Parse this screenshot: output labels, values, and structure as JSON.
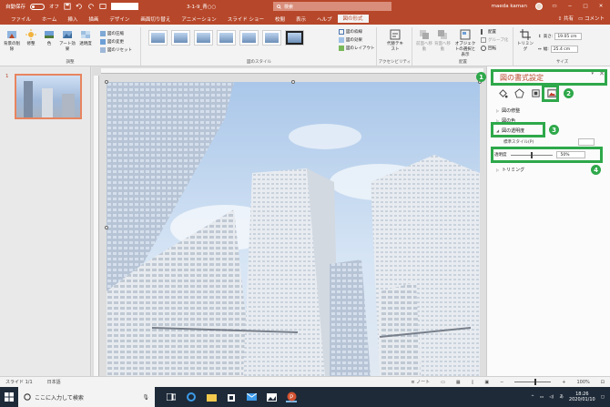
{
  "titlebar": {
    "autosave_label": "自動保存",
    "autosave_state": "オフ",
    "file_name": "3-1-9_青○○",
    "search_placeholder": "検索",
    "user_name": "maeda kaman",
    "accent_color": "#b7472a"
  },
  "tabs": [
    {
      "label": "ファイル"
    },
    {
      "label": "ホーム"
    },
    {
      "label": "挿入"
    },
    {
      "label": "描画"
    },
    {
      "label": "デザイン"
    },
    {
      "label": "画面切り替え"
    },
    {
      "label": "アニメーション"
    },
    {
      "label": "スライド ショー"
    },
    {
      "label": "校閲"
    },
    {
      "label": "表示"
    },
    {
      "label": "ヘルプ"
    },
    {
      "label": "図の形式"
    }
  ],
  "share_label": "共有",
  "comment_label": "コメント",
  "ribbon": {
    "remove_bg_label": "背景の削除",
    "corrections_label": "修整",
    "color_label": "色",
    "artistic_label": "アート効果",
    "transparency_label": "透明度",
    "compress_label": "図の圧縮",
    "change_label": "図の変更",
    "reset_label": "図のリセット",
    "adjust_group": "調整",
    "styles_group": "図のスタイル",
    "border_label": "図の枠線",
    "effects_label": "図の効果",
    "layout_label": "図のレイアウト",
    "alt_text_label": "代替テキスト",
    "accessibility_group": "アクセシビリティ",
    "forward_label": "前面へ移動",
    "backward_label": "背面へ移動",
    "selection_label": "オブジェクトの選択と表示",
    "align_label": "配置",
    "group_label": "グループ化",
    "rotate_label": "回転",
    "arrange_group": "配置",
    "crop_label": "トリミング",
    "height_label": "高さ:",
    "height_value": "19.05 cm",
    "width_label": "幅:",
    "width_value": "25.4 cm",
    "size_group": "サイズ"
  },
  "thumbs": {
    "slide_number": "1"
  },
  "pane": {
    "title": "図の書式設定",
    "sections": {
      "corrections": "図の修整",
      "color": "図の色",
      "transparency": "図の透明度",
      "crop": "トリミング"
    },
    "preset_label": "標準スタイル(P)",
    "transparency_label": "透明度",
    "transparency_value": "50%",
    "highlight_color": "#2ea84a",
    "badges": [
      "1",
      "2",
      "3",
      "4"
    ]
  },
  "statusbar": {
    "slide_info": "スライド 1/1",
    "language": "日本語",
    "notes_label": "ノート",
    "zoom": "100%"
  },
  "taskbar": {
    "search_placeholder": "ここに入力して検索",
    "time": "18:26",
    "date": "2020/01/10"
  }
}
